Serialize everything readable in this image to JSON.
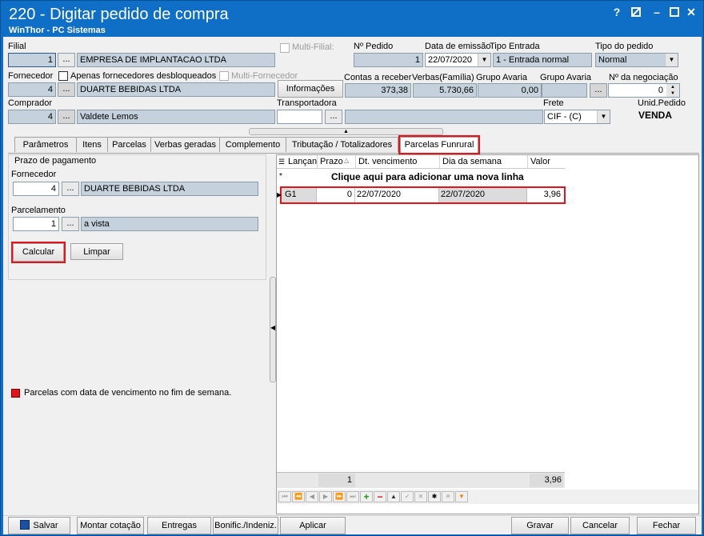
{
  "window": {
    "title": "220 - Digitar pedido de compra",
    "subtitle": "WinThor - PC Sistemas",
    "help": "?",
    "minimize": "–",
    "close": "✕"
  },
  "header": {
    "filial_label": "Filial",
    "filial_code": "1",
    "filial_name": "EMPRESA DE IMPLANTACAO LTDA",
    "multi_filial_label": "Multi-Filial:",
    "nr_pedido_label": "Nº Pedido",
    "nr_pedido_value": "1",
    "data_emissao_label": "Data de emissão",
    "data_emissao_value": "22/07/2020",
    "tipo_entrada_label": "Tipo Entrada",
    "tipo_entrada_value": "1 - Entrada normal",
    "tipo_pedido_label": "Tipo do pedido",
    "tipo_pedido_value": "Normal",
    "fornecedor_label": "Fornecedor",
    "apenas_label": "Apenas fornecedores desbloqueados",
    "multi_fornecedor_label": "Multi-Fornecedor",
    "fornecedor_code": "4",
    "fornecedor_name": "DUARTE BEBIDAS LTDA",
    "informacoes_button": "Informações",
    "contas_receber_label": "Contas a receber",
    "contas_receber_value": "373,38",
    "verbas_label": "Verbas(Família)",
    "verbas_value": "5.730,66",
    "grupo_avaria_label": "Grupo Avaria",
    "grupo_avaria_value": "0,00",
    "grupo_avaria2_label": "Grupo Avaria",
    "negociacao_label": "Nº da negociação",
    "negociacao_value": "0",
    "comprador_label": "Comprador",
    "comprador_code": "4",
    "comprador_name": "Valdete Lemos",
    "transportadora_label": "Transportadora",
    "frete_label": "Frete",
    "frete_value": "CIF - (C)",
    "unid_pedido_label": "Unid.Pedido",
    "unid_pedido_value": "VENDA",
    "ellipsis": "..."
  },
  "tabs": [
    {
      "label": "Parâmetros"
    },
    {
      "label": "Itens"
    },
    {
      "label": "Parcelas"
    },
    {
      "label": "Verbas geradas"
    },
    {
      "label": "Complemento"
    },
    {
      "label": "Tributação / Totalizadores"
    },
    {
      "label": "Parcelas Funrural"
    }
  ],
  "left_panel": {
    "group_title": "Prazo de pagamento",
    "fornecedor_label": "Fornecedor",
    "fornecedor_code": "4",
    "fornecedor_name": "DUARTE BEBIDAS LTDA",
    "parcelamento_label": "Parcelamento",
    "parcelamento_code": "1",
    "parcelamento_name": "a vista",
    "calcular_button": "Calcular",
    "limpar_button": "Limpar",
    "legend_text": "Parcelas com data de vencimento no fim de semana.",
    "legend_color": "#e3141b"
  },
  "grid": {
    "columns": [
      "Lançan",
      "Prazo",
      "Dt. vencimento",
      "Dia da semana",
      "Valor"
    ],
    "new_row_text": "Clique aqui para adicionar uma nova linha",
    "new_row_marker": "*",
    "row": {
      "lancamento": "G1",
      "prazo": "0",
      "dt_vencimento": "22/07/2020",
      "dia_semana": "22/07/2020",
      "valor": "3,96"
    },
    "footer_count": "1",
    "footer_total": "3,96"
  },
  "bottom_buttons": {
    "salvar": "Salvar",
    "montar_cotacao": "Montar cotação",
    "entregas": "Entregas",
    "bonific": "Bonific./Indeniz.",
    "aplicar": "Aplicar",
    "gravar": "Gravar",
    "cancelar": "Cancelar",
    "fechar": "Fechar"
  },
  "colors": {
    "titlebar": "#0f6fc6",
    "readonly_field": "#c5d2dd",
    "highlight": "#e3141b"
  }
}
